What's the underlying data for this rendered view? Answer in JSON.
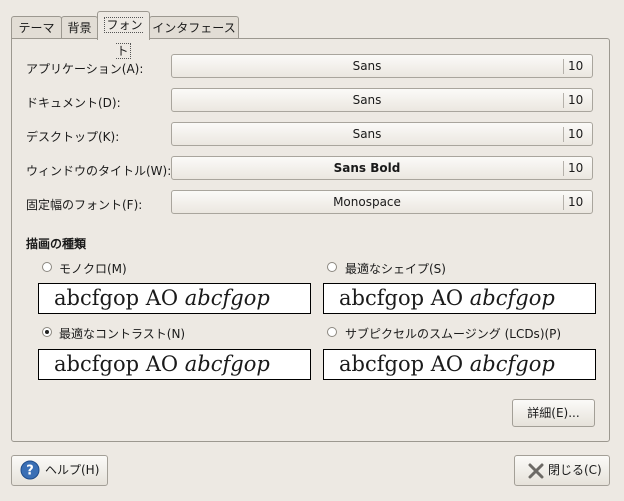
{
  "tabs": [
    {
      "label": "テーマ"
    },
    {
      "label": "背景"
    },
    {
      "label": "フォント"
    },
    {
      "label": "インタフェース"
    }
  ],
  "active_tab": "フォント",
  "fonts": [
    {
      "label": "アプリケーション(A):",
      "font": "Sans",
      "size": "10"
    },
    {
      "label": "ドキュメント(D):",
      "font": "Sans",
      "size": "10"
    },
    {
      "label": "デスクトップ(K):",
      "font": "Sans",
      "size": "10"
    },
    {
      "label": "ウィンドウのタイトル(W):",
      "font": "Sans Bold",
      "size": "10"
    },
    {
      "label": "固定幅のフォント(F):",
      "font": "Monospace",
      "size": "10"
    }
  ],
  "rendering": {
    "title": "描画の種類",
    "options": [
      {
        "label": "モノクロ(M)",
        "selected": false,
        "preview_plain": "abcfgop AO ",
        "preview_italic": "abcfgop"
      },
      {
        "label": "最適なシェイプ(S)",
        "selected": false,
        "preview_plain": "abcfgop AO ",
        "preview_italic": "abcfgop"
      },
      {
        "label": "最適なコントラスト(N)",
        "selected": true,
        "preview_plain": "abcfgop AO ",
        "preview_italic": "abcfgop"
      },
      {
        "label": "サブピクセルのスムージング (LCDs)(P)",
        "selected": false,
        "preview_plain": "abcfgop AO ",
        "preview_italic": "abcfgop"
      }
    ]
  },
  "details_button": "詳細(E)...",
  "help_button": "ヘルプ(H)",
  "close_button": "閉じる(C)",
  "colors": {
    "background": "#ede9e3",
    "help_icon": "#3a6fb5"
  },
  "icons": {
    "help": "help-icon",
    "close": "close-icon"
  }
}
